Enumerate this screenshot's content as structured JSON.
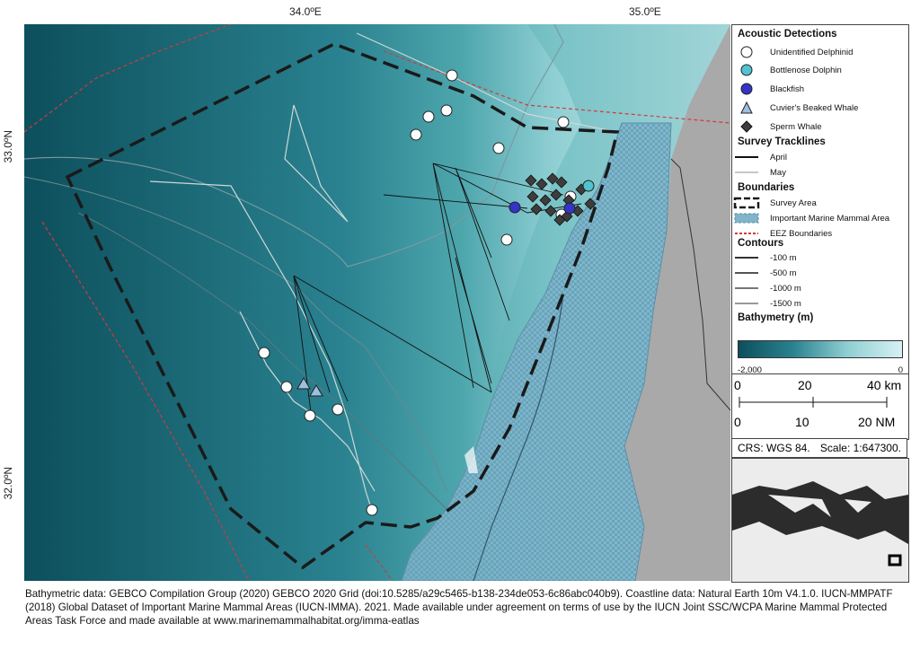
{
  "axes": {
    "lon_ticks": [
      "34.0ºE",
      "35.0ºE"
    ],
    "lat_ticks": [
      "33.0ºN",
      "32.0ºN"
    ]
  },
  "legend": {
    "acoustic_title": "Acoustic Detections",
    "species": [
      {
        "label": "Unidentified Delphinid",
        "color": "#ffffff",
        "shape": "circle"
      },
      {
        "label": "Bottlenose Dolphin",
        "color": "#4fc4cf",
        "shape": "circle"
      },
      {
        "label": "Blackfish",
        "color": "#3434c8",
        "shape": "circle"
      },
      {
        "label": "Cuvier's Beaked Whale",
        "color": "#9cc0e0",
        "shape": "triangle"
      },
      {
        "label": "Sperm Whale",
        "color": "#3d3d3d",
        "shape": "diamond"
      }
    ],
    "tracklines_title": "Survey Tracklines",
    "tracklines": [
      {
        "label": "April",
        "color": "#111111"
      },
      {
        "label": "May",
        "color": "#c8c8c8"
      }
    ],
    "boundaries_title": "Boundaries",
    "boundaries": [
      {
        "label": "Survey Area"
      },
      {
        "label": "Important Marine Mammal Area"
      },
      {
        "label": "EEZ Boundaries"
      }
    ],
    "contours_title": "Contours",
    "contours": [
      "-100 m",
      "-500 m",
      "-1000 m",
      "-1500 m"
    ],
    "bathymetry_title": "Bathymetry (m)",
    "bathy_min": "-2,000",
    "bathy_max": "0",
    "colors": {
      "deep": "#0d4f5c",
      "shallow": "#d8f0f2",
      "land": "#a9a9a9",
      "imma": "#7fb4c9",
      "eez": "#d23a3a"
    }
  },
  "scale": {
    "km_labels": [
      "0",
      "20",
      "40 km"
    ],
    "nm_labels": [
      "0",
      "10",
      "20 NM"
    ]
  },
  "crs": {
    "crs": "CRS: WGS 84.",
    "scale": "Scale: 1:647300."
  },
  "footer": "Bathymetric data: GEBCO Compilation Group (2020) GEBCO 2020 Grid (doi:10.5285/a29c5465-b138-234de053-6c86abc040b9). Coastline data: Natural Earth 10m V4.1.0. IUCN-MMPATF (2018) Global Dataset of Important Marine Mammal Areas (IUCN-IMMA). 2021. Made available under agreement on terms of use by the IUCN Joint SSC/WCPA Marine Mammal Protected Areas Task Force and made available at www.marinemammalhabitat.org/imma-eatlas"
}
